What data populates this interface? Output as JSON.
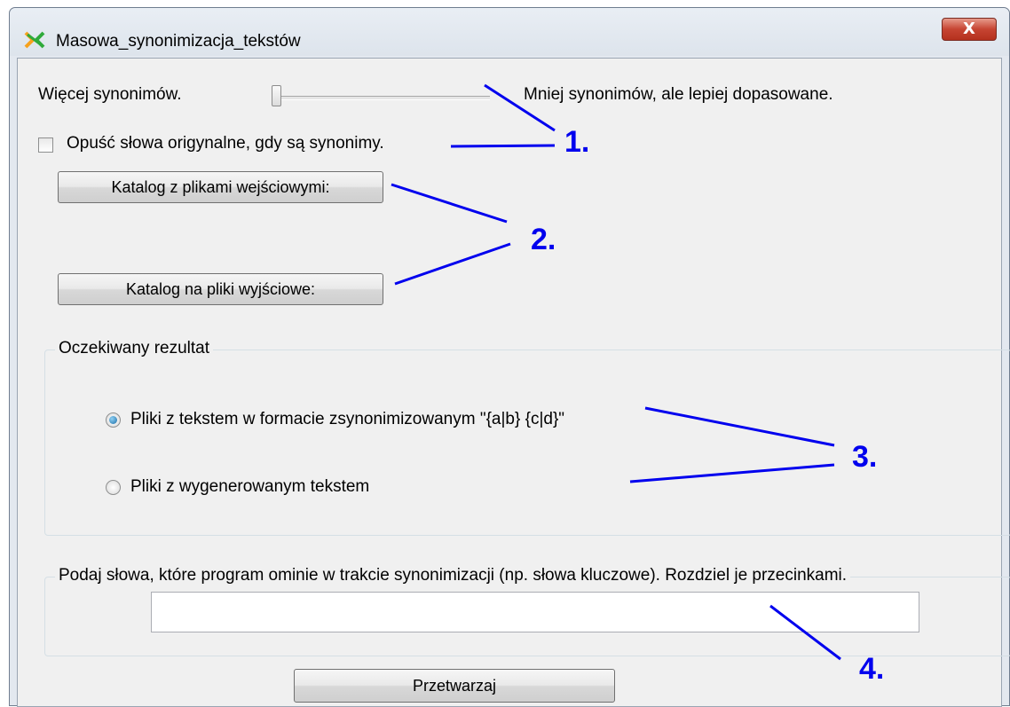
{
  "window": {
    "title": "Masowa_synonimizacja_tekstów",
    "close_label": "X"
  },
  "slider": {
    "left_label": "Więcej synonimów.",
    "right_label": "Mniej synonimów, ale lepiej dopasowane.",
    "value": 0
  },
  "checkbox": {
    "label": "Opuść słowa origynalne, gdy są synonimy.",
    "checked": false
  },
  "buttons": {
    "input_dir": "Katalog z plikami wejściowymi:",
    "output_dir": "Katalog na pliki wyjściowe:",
    "process": "Przetwarzaj"
  },
  "result_group": {
    "title": "Oczekiwany rezultat",
    "options": [
      {
        "label": "Pliki z tekstem w formacie zsynonimizowanym \"{a|b} {c|d}\"",
        "selected": true
      },
      {
        "label": "Pliki z wygenerowanym tekstem",
        "selected": false
      }
    ]
  },
  "skip_group": {
    "title": "Podaj słowa, które program ominie w trakcie synonimizacji (np. słowa kluczowe). Rozdziel je przecinkami.",
    "value": ""
  },
  "annotations": [
    "1.",
    "2.",
    "3.",
    "4."
  ],
  "colors": {
    "annotation": "#0000ee",
    "close_button": "#c64432"
  },
  "icons": {
    "app": "x-logo-icon",
    "close": "close-icon"
  }
}
